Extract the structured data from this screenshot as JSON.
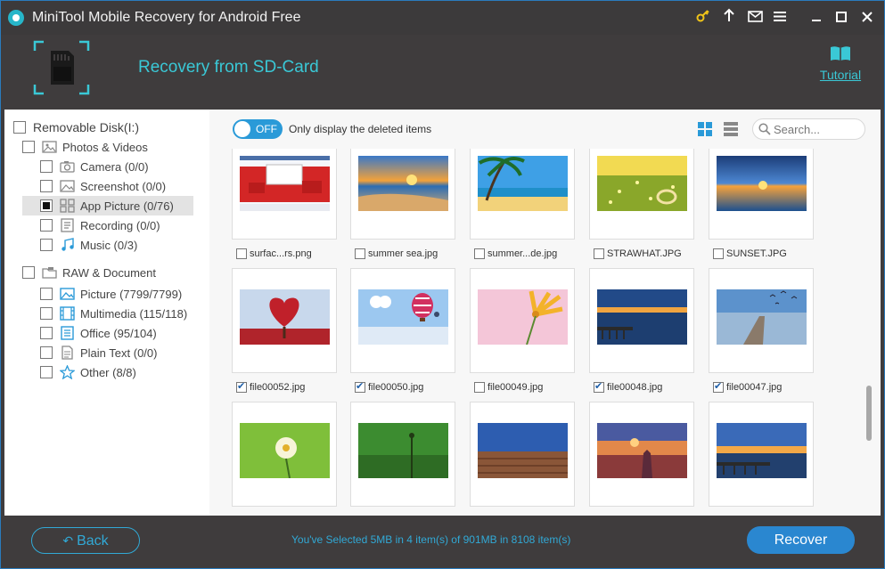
{
  "window": {
    "title": "MiniTool Mobile Recovery for Android Free",
    "controls": [
      "key-icon",
      "upload-icon",
      "mail-icon",
      "menu-icon",
      "minimize-icon",
      "maximize-icon",
      "close-icon"
    ]
  },
  "header": {
    "title": "Recovery from SD-Card",
    "tutorial_label": "Tutorial"
  },
  "tree": [
    {
      "label": "Removable Disk(I:)",
      "level": 0,
      "checked": false,
      "selected": false,
      "icon": "none"
    },
    {
      "label": "Photos & Videos",
      "level": 1,
      "checked": false,
      "selected": false,
      "icon": "photos-icon"
    },
    {
      "label": "Camera (0/0)",
      "level": 2,
      "checked": false,
      "selected": false,
      "icon": "camera-icon"
    },
    {
      "label": "Screenshot (0/0)",
      "level": 2,
      "checked": false,
      "selected": false,
      "icon": "screenshot-icon"
    },
    {
      "label": "App Picture (0/76)",
      "level": 2,
      "checked": true,
      "selected": true,
      "icon": "app-picture-icon"
    },
    {
      "label": "Recording (0/0)",
      "level": 2,
      "checked": false,
      "selected": false,
      "icon": "recording-icon"
    },
    {
      "label": "Music (0/3)",
      "level": 2,
      "checked": false,
      "selected": false,
      "icon": "music-icon"
    },
    {
      "label": "RAW & Document",
      "level": 1,
      "checked": false,
      "selected": false,
      "icon": "folder-icon"
    },
    {
      "label": "Picture (7799/7799)",
      "level": 2,
      "checked": false,
      "selected": false,
      "icon": "picture-icon"
    },
    {
      "label": "Multimedia (115/118)",
      "level": 2,
      "checked": false,
      "selected": false,
      "icon": "multimedia-icon"
    },
    {
      "label": "Office (95/104)",
      "level": 2,
      "checked": false,
      "selected": false,
      "icon": "office-icon"
    },
    {
      "label": "Plain Text (0/0)",
      "level": 2,
      "checked": false,
      "selected": false,
      "icon": "text-icon"
    },
    {
      "label": "Other (8/8)",
      "level": 2,
      "checked": false,
      "selected": false,
      "icon": "star-icon"
    }
  ],
  "toolbar": {
    "toggle_state": "OFF",
    "toggle_caption": "Only display the deleted items",
    "search_placeholder": "Search..."
  },
  "files": [
    {
      "name": "surfac...rs.png",
      "checked": false,
      "scene": "screenshot"
    },
    {
      "name": "summer sea.jpg",
      "checked": false,
      "scene": "sunset-sea"
    },
    {
      "name": "summer...de.jpg",
      "checked": false,
      "scene": "beach-palm"
    },
    {
      "name": "STRAWHAT.JPG",
      "checked": false,
      "scene": "flower-field"
    },
    {
      "name": "SUNSET.JPG",
      "checked": false,
      "scene": "sunset-water"
    },
    {
      "name": "file00052.jpg",
      "checked": true,
      "scene": "heart-tree"
    },
    {
      "name": "file00050.jpg",
      "checked": true,
      "scene": "balloon"
    },
    {
      "name": "file00049.jpg",
      "checked": false,
      "scene": "pink-flower"
    },
    {
      "name": "file00048.jpg",
      "checked": true,
      "scene": "pier-dusk"
    },
    {
      "name": "file00047.jpg",
      "checked": true,
      "scene": "pier-birds"
    },
    {
      "name": "",
      "checked": false,
      "scene": "white-flower"
    },
    {
      "name": "",
      "checked": false,
      "scene": "green-sprout"
    },
    {
      "name": "",
      "checked": false,
      "scene": "field-dusk"
    },
    {
      "name": "",
      "checked": false,
      "scene": "girl-sunset"
    },
    {
      "name": "",
      "checked": false,
      "scene": "pier-sunset"
    }
  ],
  "footer": {
    "back_label": "Back",
    "status": "You've Selected 5MB in 4 item(s) of 901MB in 8108 item(s)",
    "recover_label": "Recover"
  },
  "colors": {
    "accent": "#3ac8d6",
    "button_blue": "#2a87d0",
    "dark_bg": "#3f3c3d"
  }
}
